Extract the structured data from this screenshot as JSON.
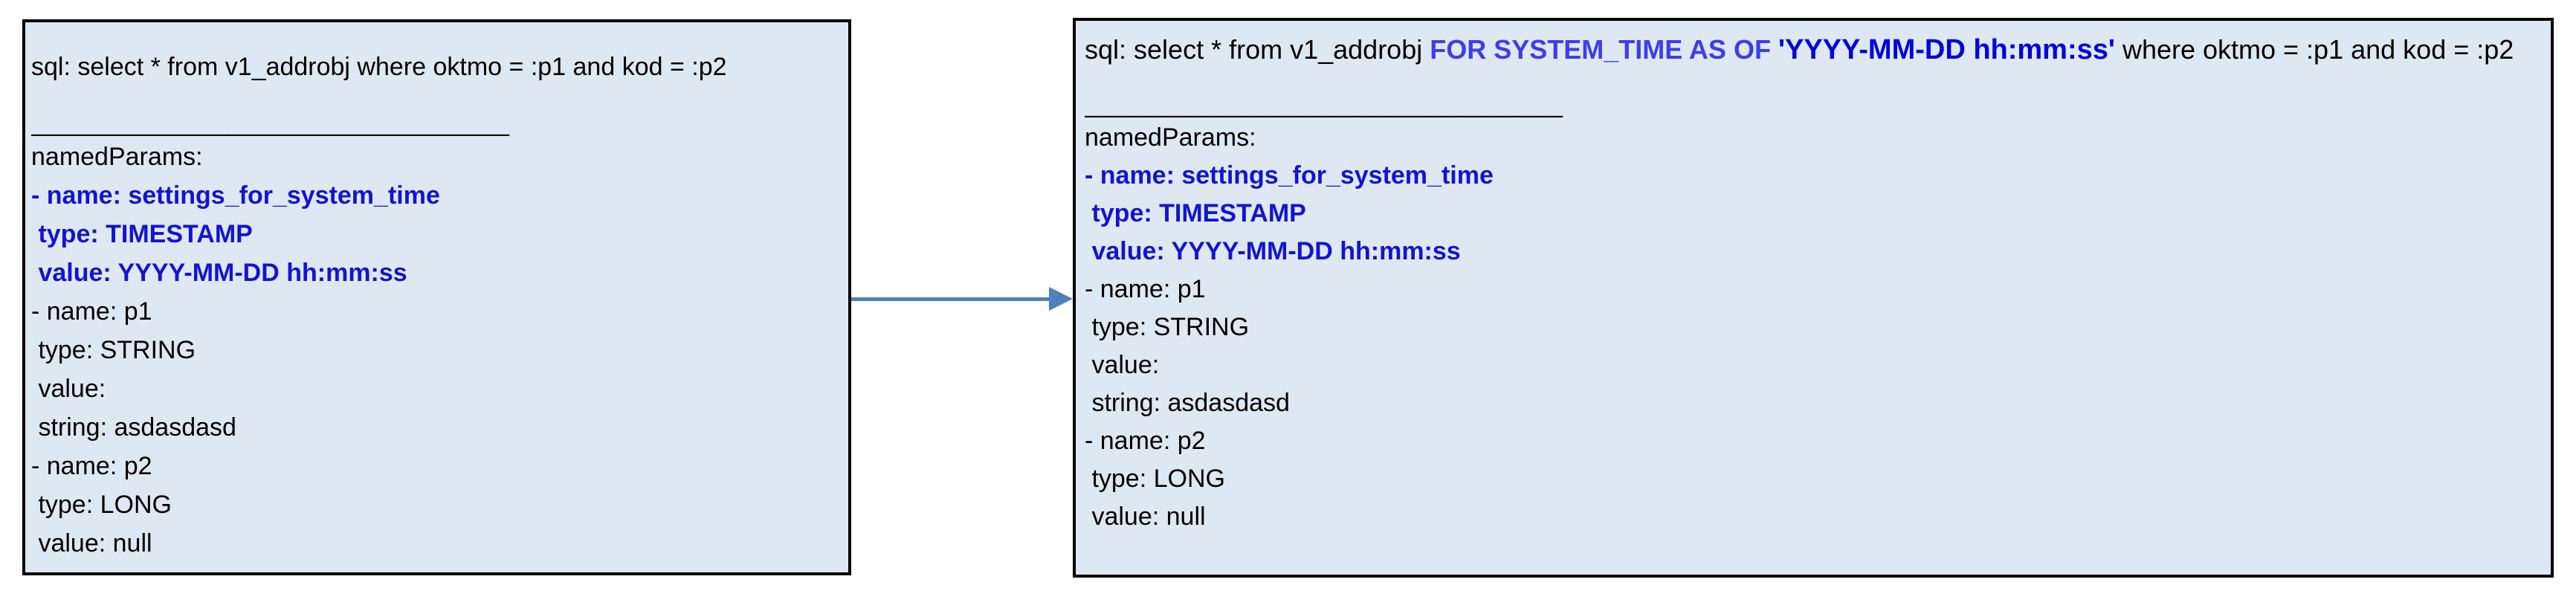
{
  "colors": {
    "box_fill": "#dee8f3",
    "box_border": "#000000",
    "text_black": "#000000",
    "param_blue": "#1313d2",
    "sql_keyword_blue": "#3d3dea",
    "sql_timestamp_blue": "#0202dc",
    "arrow_blue": "#4f81bd"
  },
  "left_box": {
    "sql_line": "sql: select * from v1_addrobj where oktmo = :p1 and kod = :p2",
    "divider": "__________________________________",
    "params_header": "namedParams:",
    "param_lines": [
      {
        "text": "- name: settings_for_system_time",
        "style": "highlight"
      },
      {
        "text": " type: TIMESTAMP",
        "style": "highlight"
      },
      {
        "text": " value: YYYY-MM-DD hh:mm:ss",
        "style": "highlight"
      },
      {
        "text": "- name: p1",
        "style": "plain"
      },
      {
        "text": " type: STRING",
        "style": "plain"
      },
      {
        "text": " value:",
        "style": "plain"
      },
      {
        "text": " string: asdasdasd",
        "style": "plain"
      },
      {
        "text": "- name: p2",
        "style": "plain"
      },
      {
        "text": " type: LONG",
        "style": "plain"
      },
      {
        "text": " value: null",
        "style": "plain"
      }
    ]
  },
  "right_box": {
    "sql_segments": [
      {
        "text": "sql: select * from v1_addrobj ",
        "style": "plain"
      },
      {
        "text": "FOR SYSTEM_TIME AS OF ",
        "style": "keyword"
      },
      {
        "text": "'YYYY-MM-DD hh:mm:ss'",
        "style": "timestamp"
      },
      {
        "text": " where oktmo = :p1 and kod = :p2",
        "style": "plain"
      }
    ],
    "divider": "__________________________________",
    "params_header": "namedParams:",
    "param_lines": [
      {
        "text": "- name: settings_for_system_time",
        "style": "highlight"
      },
      {
        "text": " type: TIMESTAMP",
        "style": "highlight"
      },
      {
        "text": " value: YYYY-MM-DD hh:mm:ss",
        "style": "highlight"
      },
      {
        "text": "- name: p1",
        "style": "plain"
      },
      {
        "text": " type: STRING",
        "style": "plain"
      },
      {
        "text": " value:",
        "style": "plain"
      },
      {
        "text": " string: asdasdasd",
        "style": "plain"
      },
      {
        "text": "- name: p2",
        "style": "plain"
      },
      {
        "text": " type: LONG",
        "style": "plain"
      },
      {
        "text": " value: null",
        "style": "plain"
      }
    ]
  },
  "arrow": {
    "direction": "right"
  }
}
